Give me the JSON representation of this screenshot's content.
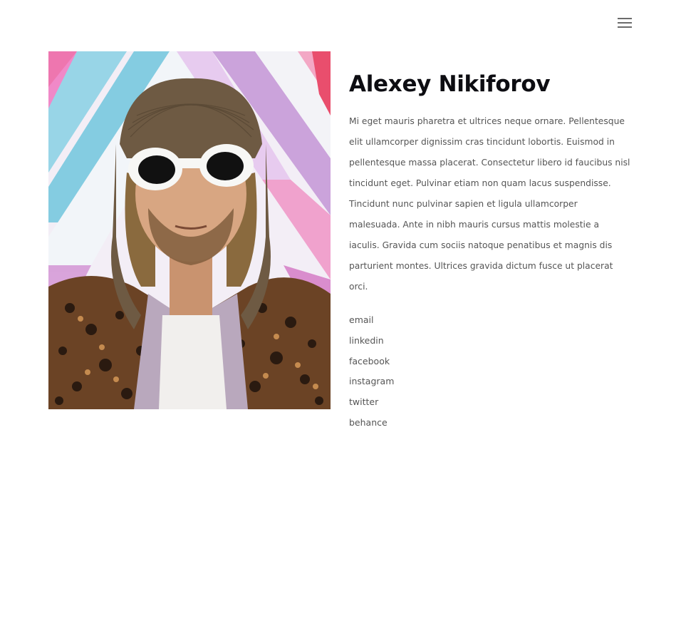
{
  "header": {
    "menu_icon": "hamburger-menu-icon"
  },
  "profile": {
    "name": "Alexey Nikiforov",
    "bio": "Mi eget mauris pharetra et ultrices neque ornare. Pellentesque elit ullamcorper dignissim cras tincidunt lobortis. Euismod in pellentesque massa placerat. Consectetur libero id faucibus nisl tincidunt eget. Pulvinar etiam non quam lacus suspendisse. Tincidunt nunc pulvinar sapien et ligula ullamcorper malesuada. Ante in nibh mauris cursus mattis molestie a iaculis. Gravida cum sociis natoque penatibus et magnis dis parturient montes. Ultrices gravida dictum fusce ut placerat orci.",
    "links": [
      "email",
      "linkedin",
      "facebook",
      "instagram",
      "twitter",
      "behance"
    ]
  },
  "colors": {
    "background": "#ffffff",
    "heading": "#0d0d12",
    "body_text": "#555555",
    "menu_icon": "#6b6b6b"
  }
}
